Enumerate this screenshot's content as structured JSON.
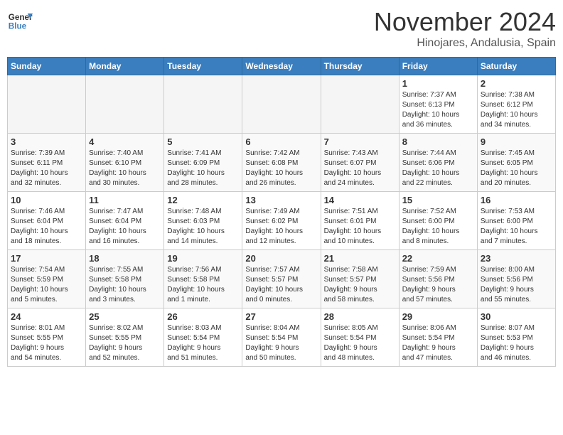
{
  "header": {
    "logo_line1": "General",
    "logo_line2": "Blue",
    "month": "November 2024",
    "location": "Hinojares, Andalusia, Spain"
  },
  "weekdays": [
    "Sunday",
    "Monday",
    "Tuesday",
    "Wednesday",
    "Thursday",
    "Friday",
    "Saturday"
  ],
  "weeks": [
    [
      {
        "day": "",
        "info": ""
      },
      {
        "day": "",
        "info": ""
      },
      {
        "day": "",
        "info": ""
      },
      {
        "day": "",
        "info": ""
      },
      {
        "day": "",
        "info": ""
      },
      {
        "day": "1",
        "info": "Sunrise: 7:37 AM\nSunset: 6:13 PM\nDaylight: 10 hours\nand 36 minutes."
      },
      {
        "day": "2",
        "info": "Sunrise: 7:38 AM\nSunset: 6:12 PM\nDaylight: 10 hours\nand 34 minutes."
      }
    ],
    [
      {
        "day": "3",
        "info": "Sunrise: 7:39 AM\nSunset: 6:11 PM\nDaylight: 10 hours\nand 32 minutes."
      },
      {
        "day": "4",
        "info": "Sunrise: 7:40 AM\nSunset: 6:10 PM\nDaylight: 10 hours\nand 30 minutes."
      },
      {
        "day": "5",
        "info": "Sunrise: 7:41 AM\nSunset: 6:09 PM\nDaylight: 10 hours\nand 28 minutes."
      },
      {
        "day": "6",
        "info": "Sunrise: 7:42 AM\nSunset: 6:08 PM\nDaylight: 10 hours\nand 26 minutes."
      },
      {
        "day": "7",
        "info": "Sunrise: 7:43 AM\nSunset: 6:07 PM\nDaylight: 10 hours\nand 24 minutes."
      },
      {
        "day": "8",
        "info": "Sunrise: 7:44 AM\nSunset: 6:06 PM\nDaylight: 10 hours\nand 22 minutes."
      },
      {
        "day": "9",
        "info": "Sunrise: 7:45 AM\nSunset: 6:05 PM\nDaylight: 10 hours\nand 20 minutes."
      }
    ],
    [
      {
        "day": "10",
        "info": "Sunrise: 7:46 AM\nSunset: 6:04 PM\nDaylight: 10 hours\nand 18 minutes."
      },
      {
        "day": "11",
        "info": "Sunrise: 7:47 AM\nSunset: 6:04 PM\nDaylight: 10 hours\nand 16 minutes."
      },
      {
        "day": "12",
        "info": "Sunrise: 7:48 AM\nSunset: 6:03 PM\nDaylight: 10 hours\nand 14 minutes."
      },
      {
        "day": "13",
        "info": "Sunrise: 7:49 AM\nSunset: 6:02 PM\nDaylight: 10 hours\nand 12 minutes."
      },
      {
        "day": "14",
        "info": "Sunrise: 7:51 AM\nSunset: 6:01 PM\nDaylight: 10 hours\nand 10 minutes."
      },
      {
        "day": "15",
        "info": "Sunrise: 7:52 AM\nSunset: 6:00 PM\nDaylight: 10 hours\nand 8 minutes."
      },
      {
        "day": "16",
        "info": "Sunrise: 7:53 AM\nSunset: 6:00 PM\nDaylight: 10 hours\nand 7 minutes."
      }
    ],
    [
      {
        "day": "17",
        "info": "Sunrise: 7:54 AM\nSunset: 5:59 PM\nDaylight: 10 hours\nand 5 minutes."
      },
      {
        "day": "18",
        "info": "Sunrise: 7:55 AM\nSunset: 5:58 PM\nDaylight: 10 hours\nand 3 minutes."
      },
      {
        "day": "19",
        "info": "Sunrise: 7:56 AM\nSunset: 5:58 PM\nDaylight: 10 hours\nand 1 minute."
      },
      {
        "day": "20",
        "info": "Sunrise: 7:57 AM\nSunset: 5:57 PM\nDaylight: 10 hours\nand 0 minutes."
      },
      {
        "day": "21",
        "info": "Sunrise: 7:58 AM\nSunset: 5:57 PM\nDaylight: 9 hours\nand 58 minutes."
      },
      {
        "day": "22",
        "info": "Sunrise: 7:59 AM\nSunset: 5:56 PM\nDaylight: 9 hours\nand 57 minutes."
      },
      {
        "day": "23",
        "info": "Sunrise: 8:00 AM\nSunset: 5:56 PM\nDaylight: 9 hours\nand 55 minutes."
      }
    ],
    [
      {
        "day": "24",
        "info": "Sunrise: 8:01 AM\nSunset: 5:55 PM\nDaylight: 9 hours\nand 54 minutes."
      },
      {
        "day": "25",
        "info": "Sunrise: 8:02 AM\nSunset: 5:55 PM\nDaylight: 9 hours\nand 52 minutes."
      },
      {
        "day": "26",
        "info": "Sunrise: 8:03 AM\nSunset: 5:54 PM\nDaylight: 9 hours\nand 51 minutes."
      },
      {
        "day": "27",
        "info": "Sunrise: 8:04 AM\nSunset: 5:54 PM\nDaylight: 9 hours\nand 50 minutes."
      },
      {
        "day": "28",
        "info": "Sunrise: 8:05 AM\nSunset: 5:54 PM\nDaylight: 9 hours\nand 48 minutes."
      },
      {
        "day": "29",
        "info": "Sunrise: 8:06 AM\nSunset: 5:54 PM\nDaylight: 9 hours\nand 47 minutes."
      },
      {
        "day": "30",
        "info": "Sunrise: 8:07 AM\nSunset: 5:53 PM\nDaylight: 9 hours\nand 46 minutes."
      }
    ]
  ]
}
